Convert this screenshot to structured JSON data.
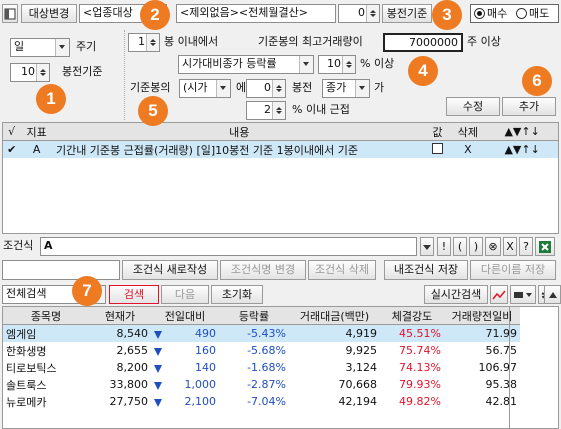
{
  "toolbar": {
    "target_change": "대상변경",
    "universe_combo": "<업종대상",
    "exclude_field": "<제외없음><전체월결산>",
    "bar_offset": "0",
    "bar_offset_label": "봉전기준",
    "radio_buy": "매수",
    "radio_sell": "매도"
  },
  "period": {
    "unit": "일",
    "unit_label": "주기",
    "base_value": "10",
    "base_label": "봉전기준"
  },
  "condition": {
    "line1": {
      "within": "1",
      "text1": "봉 이내에서",
      "text2": "기준봉의 최고거래량이",
      "volume": "7000000",
      "text3": "주 이상"
    },
    "line2": {
      "compare": "시가대비종가 등락률",
      "pct": "10",
      "text": "% 이상"
    },
    "line3": {
      "prefix": "기준봉의",
      "price_type": "(시가",
      "text_at": "에",
      "bars": "0",
      "text_bars": "봉전",
      "price2": "종가",
      "text_ga": "가"
    },
    "line4": {
      "pct": "2",
      "text": "% 이내 근접"
    },
    "modify_button": "수정",
    "add_button": "추가"
  },
  "condition_list": {
    "headers": [
      "√",
      "지표",
      "내용",
      "값",
      "삭제",
      "▲▼↑↓"
    ],
    "rows": [
      {
        "checked": "✔",
        "id": "A",
        "content": "기간내 기준봉 근접률(거래량) [일]10봉전 기준 1봉이내에서 기준",
        "delete": "X",
        "move": "▲▼↑↓"
      }
    ]
  },
  "formula": {
    "label": "조건식",
    "value": "A",
    "ops": [
      "!",
      "(",
      ")",
      "⊗",
      "X",
      "?"
    ]
  },
  "actions": {
    "new_condition": "조건식 새로작성",
    "rename": "조건식명 변경",
    "delete": "조건식 삭제",
    "save_mine": "내조건식 저장",
    "save_as": "다른이름 저장"
  },
  "search": {
    "scope": "전체검색",
    "search_button": "검색",
    "next_button": "다음",
    "reset_button": "초기화",
    "realtime_button": "실시간검색"
  },
  "results": {
    "headers": [
      "종목명",
      "현재가",
      "전일대비",
      "등락률",
      "거래대금(백만)",
      "체결강도",
      "거래량전일비"
    ],
    "rows": [
      {
        "name": "엠게임",
        "price": "8,540",
        "change": "490",
        "rate": "-5.43%",
        "amount": "4,919",
        "strength": "45.51%",
        "vol_ratio": "71.99"
      },
      {
        "name": "한화생명",
        "price": "2,655",
        "change": "160",
        "rate": "-5.68%",
        "amount": "9,925",
        "strength": "75.74%",
        "vol_ratio": "56.75"
      },
      {
        "name": "티로보틱스",
        "price": "8,200",
        "change": "140",
        "rate": "-1.68%",
        "amount": "3,124",
        "strength": "74.13%",
        "vol_ratio": "106.97"
      },
      {
        "name": "솔트룩스",
        "price": "33,800",
        "change": "1,000",
        "rate": "-2.87%",
        "amount": "70,668",
        "strength": "79.93%",
        "vol_ratio": "95.38"
      },
      {
        "name": "뉴로메카",
        "price": "27,750",
        "change": "2,100",
        "rate": "-7.04%",
        "amount": "42,194",
        "strength": "49.82%",
        "vol_ratio": "42.81"
      }
    ]
  },
  "annotations": {
    "b1": "1",
    "b2": "2",
    "b3": "3",
    "b4": "4",
    "b5": "5",
    "b6": "6",
    "b7": "7"
  },
  "colors": {
    "accent_orange": "#ee7a22",
    "up_red": "#e0142c",
    "down_blue": "#1f4fbf",
    "highlight": "#cfe8f8"
  }
}
